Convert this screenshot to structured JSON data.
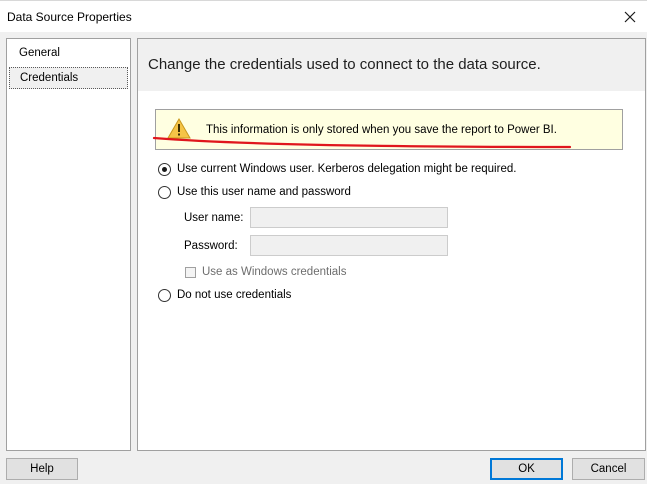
{
  "window": {
    "title": "Data Source Properties"
  },
  "nav": {
    "items": [
      {
        "label": "General",
        "selected": false
      },
      {
        "label": "Credentials",
        "selected": true
      }
    ]
  },
  "content": {
    "title": "Change the credentials used to connect to the data source.",
    "info_banner": {
      "icon": "warning-icon",
      "text": "This information is only stored when you save the report to Power BI."
    },
    "options": [
      {
        "label": "Use current Windows user. Kerberos delegation might be required.",
        "checked": true
      },
      {
        "label": "Use this user name and password",
        "checked": false
      },
      {
        "label": "Do not use credentials",
        "checked": false
      }
    ],
    "fields": {
      "username": {
        "label": "User name:",
        "value": ""
      },
      "password": {
        "label": "Password:",
        "value": ""
      }
    },
    "windows_credentials": {
      "label": "Use as Windows credentials",
      "checked": false,
      "enabled": false
    },
    "annotation_color": "#e0161c"
  },
  "buttons": {
    "help": "Help",
    "ok": "OK",
    "cancel": "Cancel"
  },
  "colors": {
    "accent": "#0078d7",
    "banner_bg": "#ffffe1",
    "warning": "#f5c447"
  }
}
